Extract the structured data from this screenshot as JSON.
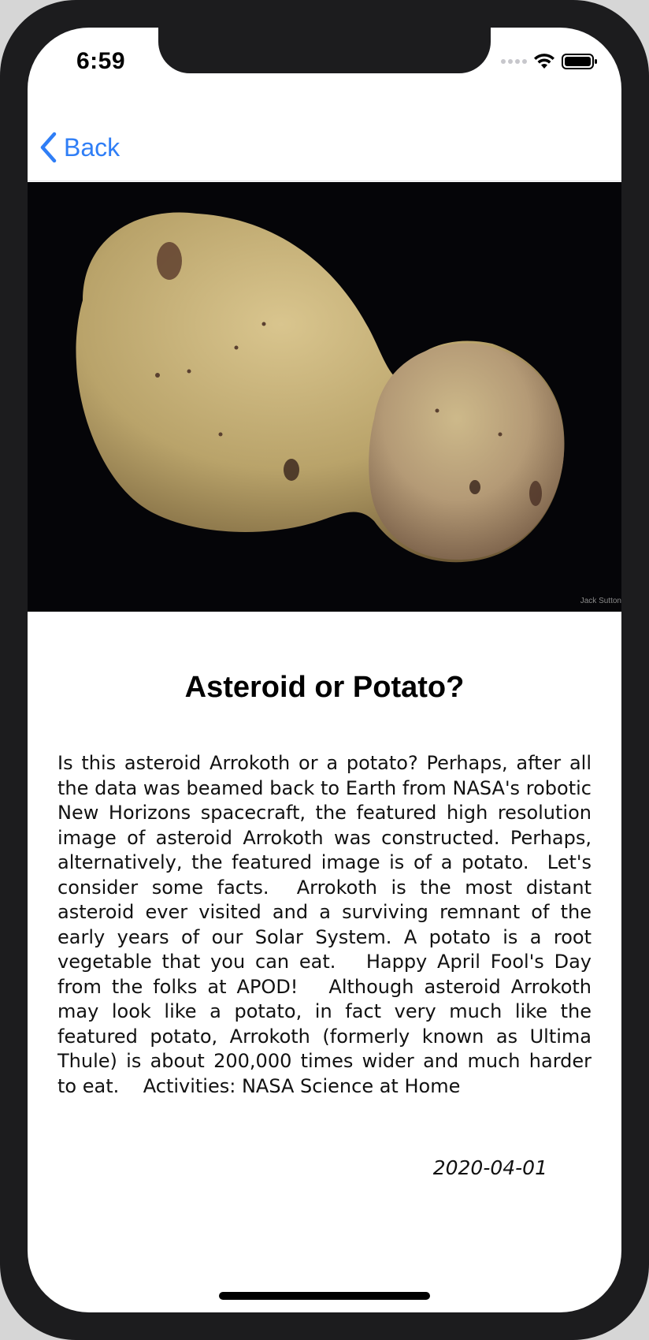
{
  "status_bar": {
    "time": "6:59"
  },
  "nav": {
    "back_label": "Back"
  },
  "image": {
    "credit": "Jack Sutton",
    "subject": "potato"
  },
  "article": {
    "title": "Asteroid or Potato?",
    "explanation": "Is this asteroid Arrokoth or a potato? Perhaps, after all the data was beamed back to Earth from NASA's robotic New Horizons spacecraft, the featured high resolution image of asteroid Arrokoth was constructed. Perhaps, alternatively, the featured image is of a potato.  Let's consider some facts.  Arrokoth is the most distant asteroid ever visited and a surviving remnant of the early years of our Solar System. A potato is a root vegetable that you can eat.   Happy April Fool's Day from the folks at APOD!   Although asteroid Arrokoth may look like a potato, in fact very much like the featured potato, Arrokoth (formerly known as Ultima Thule) is about 200,000 times wider and much harder to eat.    Activities: NASA Science at Home",
    "date": "2020-04-01"
  },
  "colors": {
    "accent": "#2f7ef6",
    "frame": "#1c1c1e",
    "image_background": "#050508"
  },
  "icons": {
    "back": "chevron-left-icon",
    "wifi": "wifi-icon",
    "battery": "battery-icon",
    "signal": "cellular-signal-icon"
  }
}
